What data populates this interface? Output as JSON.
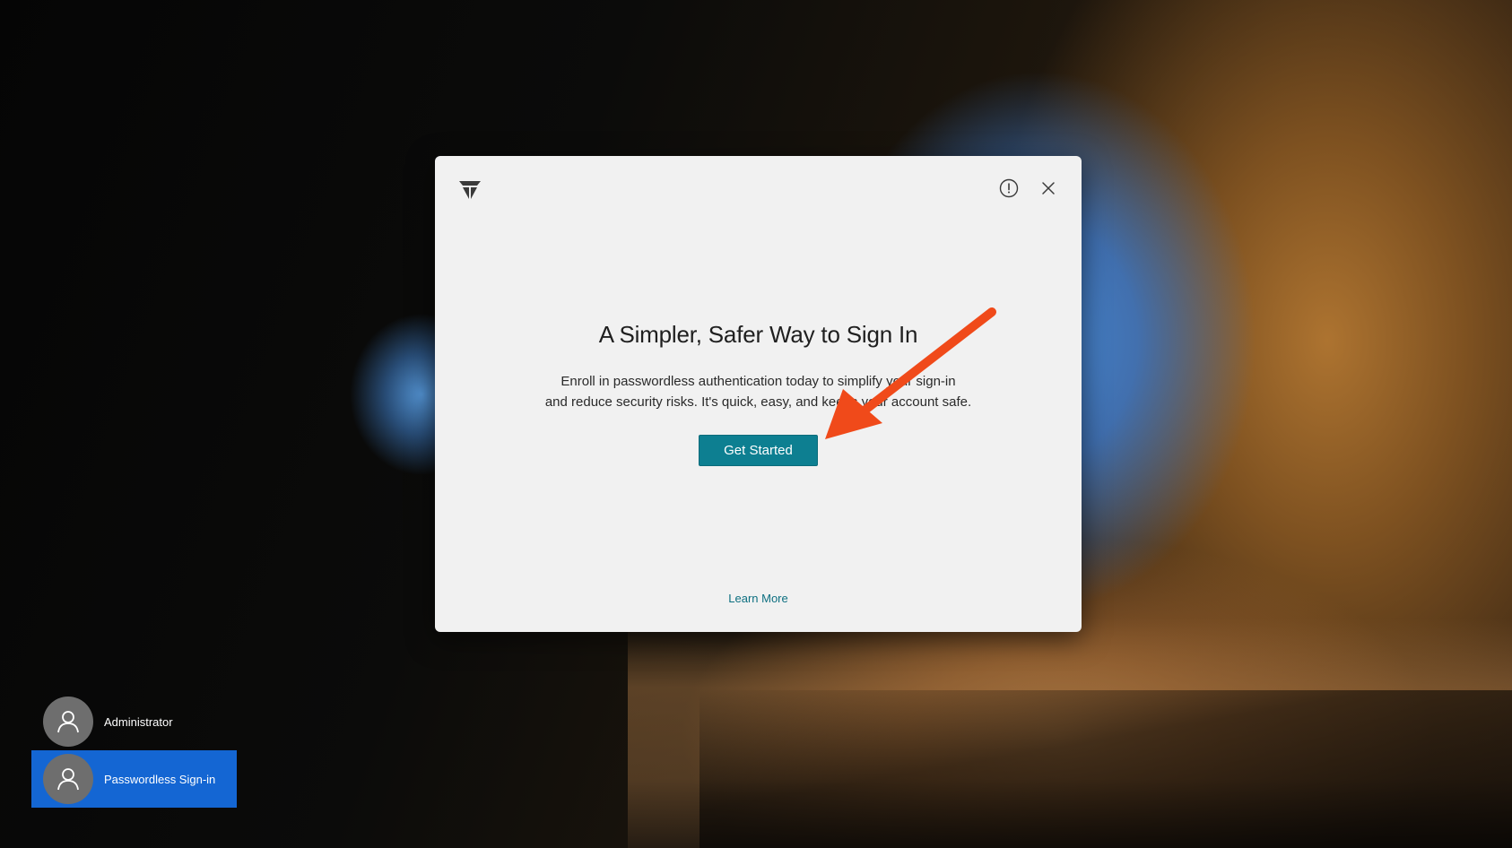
{
  "dialog": {
    "title": "A Simpler, Safer Way to Sign In",
    "body_line1": "Enroll in passwordless authentication today to simplify your sign-in",
    "body_line2": "and reduce security risks. It's quick, easy, and keeps your account safe.",
    "primary_button": "Get Started",
    "learn_more": "Learn More",
    "icons": {
      "logo": "brand-logo-icon",
      "info": "info-icon",
      "close": "close-icon"
    },
    "accent_color": "#0d7f91"
  },
  "annotation": {
    "arrow_color": "#f04a1a"
  },
  "users": [
    {
      "name": "Administrator",
      "selected": false
    },
    {
      "name": "Passwordless Sign-in",
      "selected": true
    }
  ],
  "colors": {
    "selected_user_bg": "#1466d3",
    "avatar_bg": "#6e6e6e"
  }
}
